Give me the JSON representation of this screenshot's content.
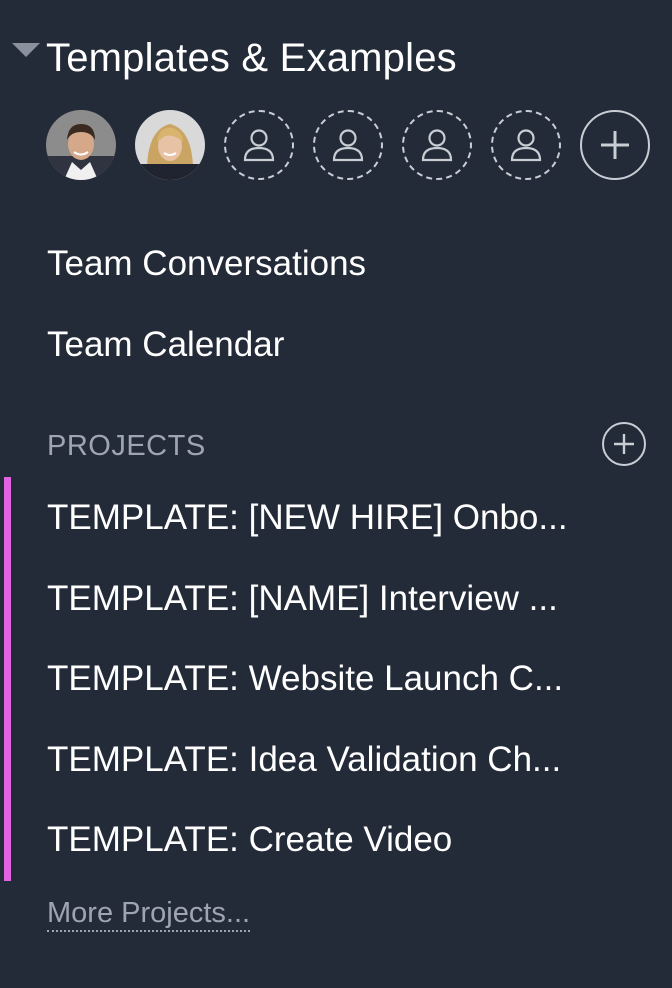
{
  "team": {
    "title": "Templates & Examples"
  },
  "members": {
    "avatars": [
      {
        "name": "avatar-man"
      },
      {
        "name": "avatar-woman"
      }
    ],
    "placeholder_count": 4,
    "add_icon": "plus-icon"
  },
  "nav": {
    "conversations": "Team Conversations",
    "calendar": "Team Calendar"
  },
  "projects": {
    "heading": "PROJECTS",
    "accent_color": "#e362e3",
    "items": [
      "TEMPLATE: [NEW HIRE] Onbo...",
      "TEMPLATE: [NAME] Interview ...",
      "TEMPLATE: Website Launch C...",
      "TEMPLATE: Idea Validation Ch...",
      "TEMPLATE: Create Video"
    ],
    "more": "More Projects..."
  },
  "colors": {
    "background": "#242b38",
    "muted_text": "#9ea5b1"
  }
}
